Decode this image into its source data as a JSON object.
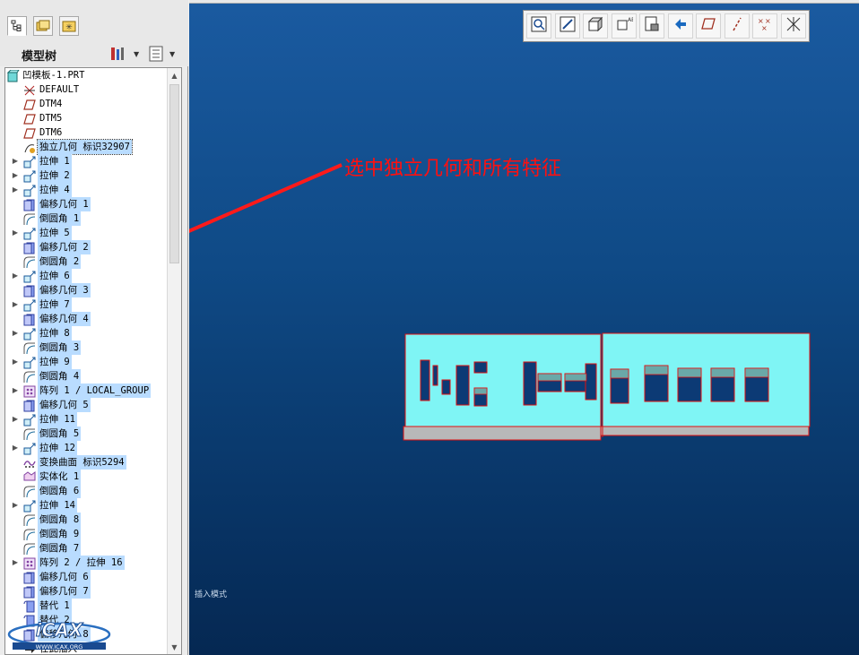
{
  "panel": {
    "title": "模型树"
  },
  "tree": {
    "items": [
      {
        "label": "凹模板-1.PRT",
        "icon": "part-icon",
        "expander": false,
        "selected": false
      },
      {
        "label": "DEFAULT",
        "icon": "coordinate-system-icon",
        "expander": false,
        "selected": false
      },
      {
        "label": "DTM4",
        "icon": "datum-plane-icon",
        "expander": false,
        "selected": false
      },
      {
        "label": "DTM5",
        "icon": "datum-plane-icon",
        "expander": false,
        "selected": false
      },
      {
        "label": "DTM6",
        "icon": "datum-plane-icon",
        "expander": false,
        "selected": false
      },
      {
        "label": "独立几何 标识32907",
        "icon": "independent-geometry-icon",
        "expander": false,
        "selected": true,
        "dotted": true
      },
      {
        "label": "拉伸 1",
        "icon": "extrude-icon",
        "expander": true,
        "selected": true
      },
      {
        "label": "拉伸 2",
        "icon": "extrude-icon",
        "expander": true,
        "selected": true
      },
      {
        "label": "拉伸 4",
        "icon": "extrude-icon",
        "expander": true,
        "selected": true
      },
      {
        "label": "偏移几何 1",
        "icon": "offset-geometry-icon",
        "expander": false,
        "selected": true
      },
      {
        "label": "倒圆角 1",
        "icon": "round-icon",
        "expander": false,
        "selected": true
      },
      {
        "label": "拉伸 5",
        "icon": "extrude-icon",
        "expander": true,
        "selected": true
      },
      {
        "label": "偏移几何 2",
        "icon": "offset-geometry-icon",
        "expander": false,
        "selected": true
      },
      {
        "label": "倒圆角 2",
        "icon": "round-icon",
        "expander": false,
        "selected": true
      },
      {
        "label": "拉伸 6",
        "icon": "extrude-icon",
        "expander": true,
        "selected": true
      },
      {
        "label": "偏移几何 3",
        "icon": "offset-geometry-icon",
        "expander": false,
        "selected": true
      },
      {
        "label": "拉伸 7",
        "icon": "extrude-icon",
        "expander": true,
        "selected": true
      },
      {
        "label": "偏移几何 4",
        "icon": "offset-geometry-icon",
        "expander": false,
        "selected": true
      },
      {
        "label": "拉伸 8",
        "icon": "extrude-icon",
        "expander": true,
        "selected": true
      },
      {
        "label": "倒圆角 3",
        "icon": "round-icon",
        "expander": false,
        "selected": true
      },
      {
        "label": "拉伸 9",
        "icon": "extrude-icon",
        "expander": true,
        "selected": true
      },
      {
        "label": "倒圆角 4",
        "icon": "round-icon",
        "expander": false,
        "selected": true
      },
      {
        "label": "阵列 1 / LOCAL_GROUP",
        "icon": "pattern-icon",
        "expander": true,
        "selected": true
      },
      {
        "label": "偏移几何 5",
        "icon": "offset-geometry-icon",
        "expander": false,
        "selected": true
      },
      {
        "label": "拉伸 11",
        "icon": "extrude-icon",
        "expander": true,
        "selected": true
      },
      {
        "label": "倒圆角 5",
        "icon": "round-icon",
        "expander": false,
        "selected": true
      },
      {
        "label": "拉伸 12",
        "icon": "extrude-icon",
        "expander": true,
        "selected": true
      },
      {
        "label": "变换曲面 标识5294",
        "icon": "transform-surface-icon",
        "expander": false,
        "selected": true
      },
      {
        "label": "实体化 1",
        "icon": "solidify-icon",
        "expander": false,
        "selected": true
      },
      {
        "label": "倒圆角 6",
        "icon": "round-icon",
        "expander": false,
        "selected": true
      },
      {
        "label": "拉伸 14",
        "icon": "extrude-icon",
        "expander": true,
        "selected": true
      },
      {
        "label": "倒圆角 8",
        "icon": "round-icon",
        "expander": false,
        "selected": true
      },
      {
        "label": "倒圆角 9",
        "icon": "round-icon",
        "expander": false,
        "selected": true
      },
      {
        "label": "倒圆角 7",
        "icon": "round-icon",
        "expander": false,
        "selected": true
      },
      {
        "label": "阵列 2 / 拉伸 16",
        "icon": "pattern-icon",
        "expander": true,
        "selected": true
      },
      {
        "label": "偏移几何 6",
        "icon": "offset-geometry-icon",
        "expander": false,
        "selected": true
      },
      {
        "label": "偏移几何 7",
        "icon": "offset-geometry-icon",
        "expander": false,
        "selected": true
      },
      {
        "label": "替代 1",
        "icon": "replace-icon",
        "expander": false,
        "selected": true
      },
      {
        "label": "替代 2",
        "icon": "replace-icon",
        "expander": false,
        "selected": true
      },
      {
        "label": "偏移几何 8",
        "icon": "offset-geometry-icon",
        "expander": false,
        "selected": true
      },
      {
        "label": "在此插入",
        "icon": "insert-here-icon",
        "expander": false,
        "selected": false
      }
    ]
  },
  "viewport": {
    "annotation": "选中独立几何和所有特征",
    "status_text": "插入模式",
    "toolbar_icons": [
      "refit-icon",
      "repaint-icon",
      "shading-icon",
      "saved-views-icon",
      "view-manager-icon",
      "orient-icon",
      "datum-planes-icon",
      "datum-axes-icon",
      "datum-points-icon",
      "coordinate-systems-icon"
    ]
  },
  "logo": {
    "text": "iCAX",
    "url_text": "WWW.ICAX.ORG"
  },
  "colors": {
    "selection": "#b9dcff",
    "viewport_top": "#1a5aa0",
    "viewport_bottom": "#052852",
    "annotation": "#ff1010",
    "model_face": "#7ff5f5",
    "model_edge": "#e01010"
  }
}
